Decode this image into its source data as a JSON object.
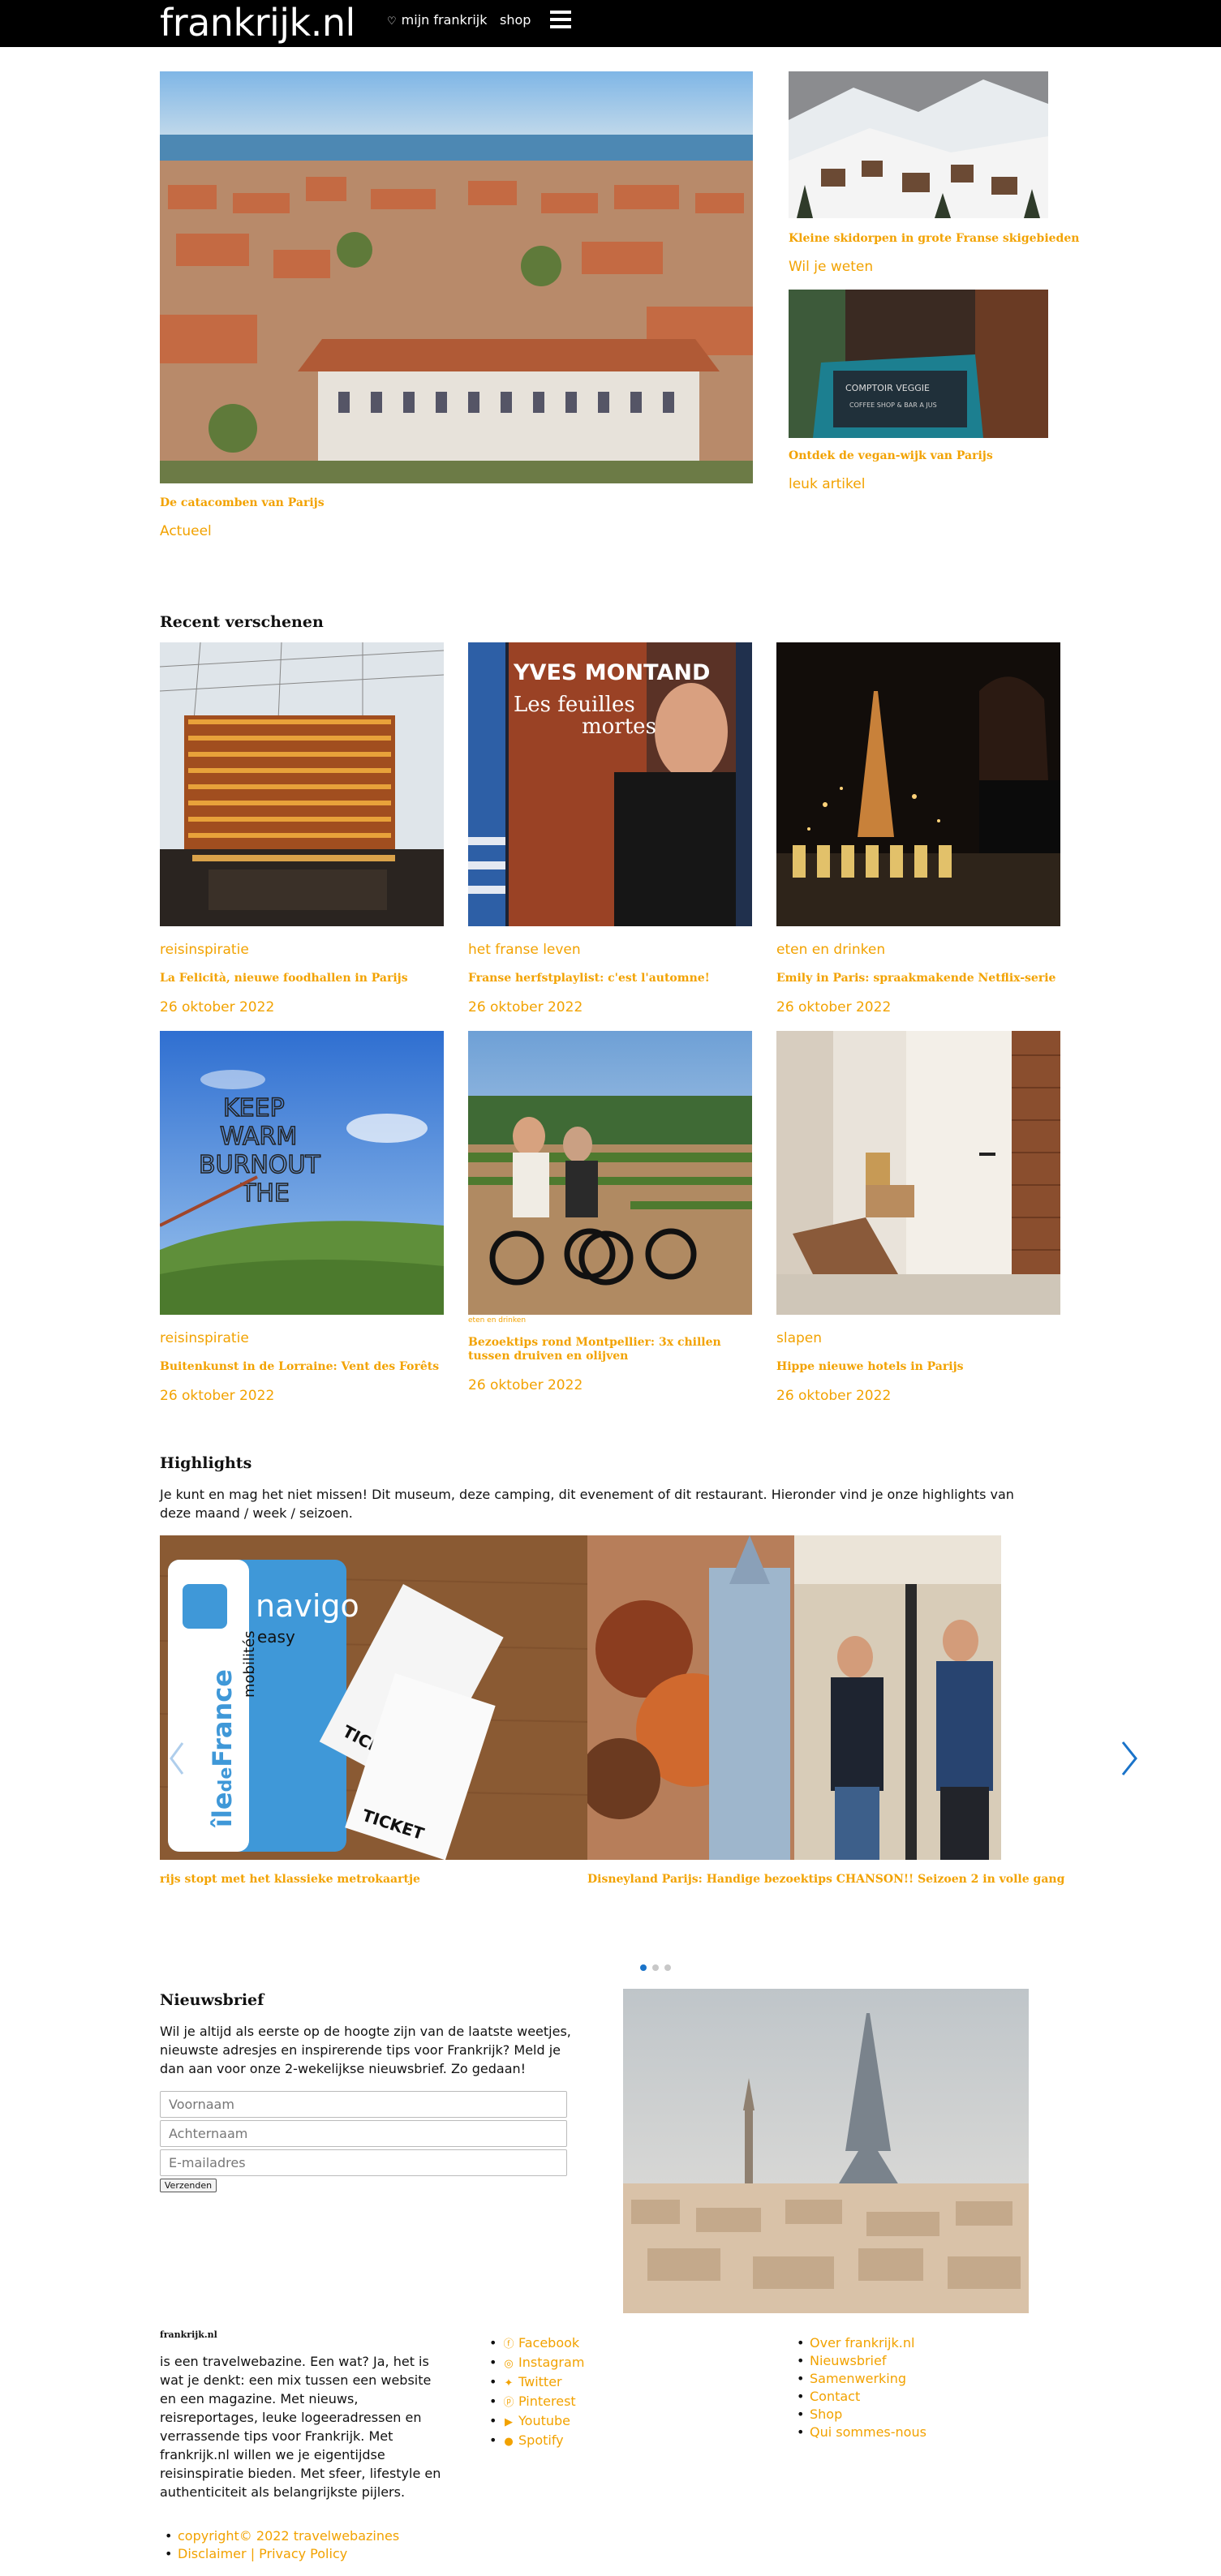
{
  "header": {
    "logo": "frankrijk.nl",
    "heart": "♡",
    "mijn_frankrijk": "mijn frankrijk",
    "shop": "shop"
  },
  "featured": {
    "main": {
      "title": "De catacomben van Parijs",
      "tag": "Actueel"
    },
    "side1": {
      "title": "Kleine skidorpen in grote Franse skigebieden",
      "tag": "Wil je weten"
    },
    "side2": {
      "title": "Ontdek de vegan-wijk van Parijs",
      "tag": "leuk artikel"
    }
  },
  "recent": {
    "heading": "Recent verschenen",
    "cards": [
      {
        "category": "reisinspiratie",
        "title": "La Felicità, nieuwe foodhallen in Parijs",
        "date": "26 oktober 2022"
      },
      {
        "category": "het franse leven",
        "title": "Franse herfstplaylist: c'est l'automne!",
        "date": "26 oktober 2022"
      },
      {
        "category": "eten en drinken",
        "title": "Emily in Paris: spraakmakende Netflix-serie",
        "date": "26 oktober 2022"
      },
      {
        "category": "reisinspiratie",
        "title": "Buitenkunst in de Lorraine: Vent des Forêts",
        "date": "26 oktober 2022"
      },
      {
        "category": "eten en drinken",
        "title": "Bezoektips rond Montpellier: 3x chillen tussen druiven en olijven",
        "date": "26 oktober 2022"
      },
      {
        "category": "slapen",
        "title": "Hippe nieuwe hotels in Parijs",
        "date": "26 oktober 2022"
      }
    ],
    "image_texts": {
      "montand_name": "YVES MONTAND",
      "montand_album_1": "Les feuilles",
      "montand_album_2": "mortes",
      "art_words": [
        "KEEP",
        "WARM",
        "BURNOUT",
        "THE"
      ]
    }
  },
  "highlights": {
    "heading": "Highlights",
    "intro": "Je kunt en mag het niet missen! Dit museum, deze camping, dit evenement of dit restaurant. Hieronder vind je onze highlights van deze maand / week / seizoen.",
    "slides": [
      {
        "caption": "rijs stopt met het klassieke metrokaartje"
      },
      {
        "caption": "Disneyland Parijs: Handige bezoektips CHANSON!! Seizoen 2 in volle gang"
      }
    ],
    "navigo_card": {
      "brand": "navigo",
      "sub": "easy",
      "region_1": "île",
      "region_2": "de",
      "region_3": "France",
      "region_4": "mobilités"
    },
    "ticket_text": "TICKET",
    "dots_total": 3,
    "dots_active": 1
  },
  "newsletter": {
    "heading": "Nieuwsbrief",
    "text": "Wil je altijd als eerste op de hoogte zijn van de laatste weetjes, nieuwste adresjes en inspirerende tips voor Frankrijk? Meld je dan aan voor onze 2-wekelijkse nieuwsbrief. Zo gedaan!",
    "first_name_placeholder": "Voornaam",
    "last_name_placeholder": "Achternaam",
    "email_placeholder": "E-mailadres",
    "submit": "Verzenden"
  },
  "footer": {
    "brand": "frankrijk.nl",
    "about": "is een travelwebazine. Een wat? Ja, het is wat je denkt: een mix tussen een website en een magazine. Met nieuws, reisreportages, leuke logeeradressen en verrassende tips voor Frankrijk. Met frankrijk.nl willen we je eigentijdse reisinspiratie bieden. Met sfeer, lifestyle en authenticiteit als belangrijkste pijlers.",
    "social": [
      {
        "icon": "facebook-icon",
        "label": "Facebook"
      },
      {
        "icon": "instagram-icon",
        "label": "Instagram"
      },
      {
        "icon": "twitter-icon",
        "label": "Twitter"
      },
      {
        "icon": "pinterest-icon",
        "label": "Pinterest"
      },
      {
        "icon": "youtube-icon",
        "label": "Youtube"
      },
      {
        "icon": "spotify-icon",
        "label": "Spotify"
      }
    ],
    "links": [
      "Over frankrijk.nl",
      "Nieuwsbrief",
      "Samenwerking",
      "Contact",
      "Shop",
      "Qui sommes-nous"
    ],
    "copyright": "copyright© 2022 travelwebazines",
    "legal": "Disclaimer | Privacy Policy"
  },
  "colors": {
    "accent": "#f2a200",
    "header_bg": "#000000",
    "arrow": "#1a73c9"
  }
}
